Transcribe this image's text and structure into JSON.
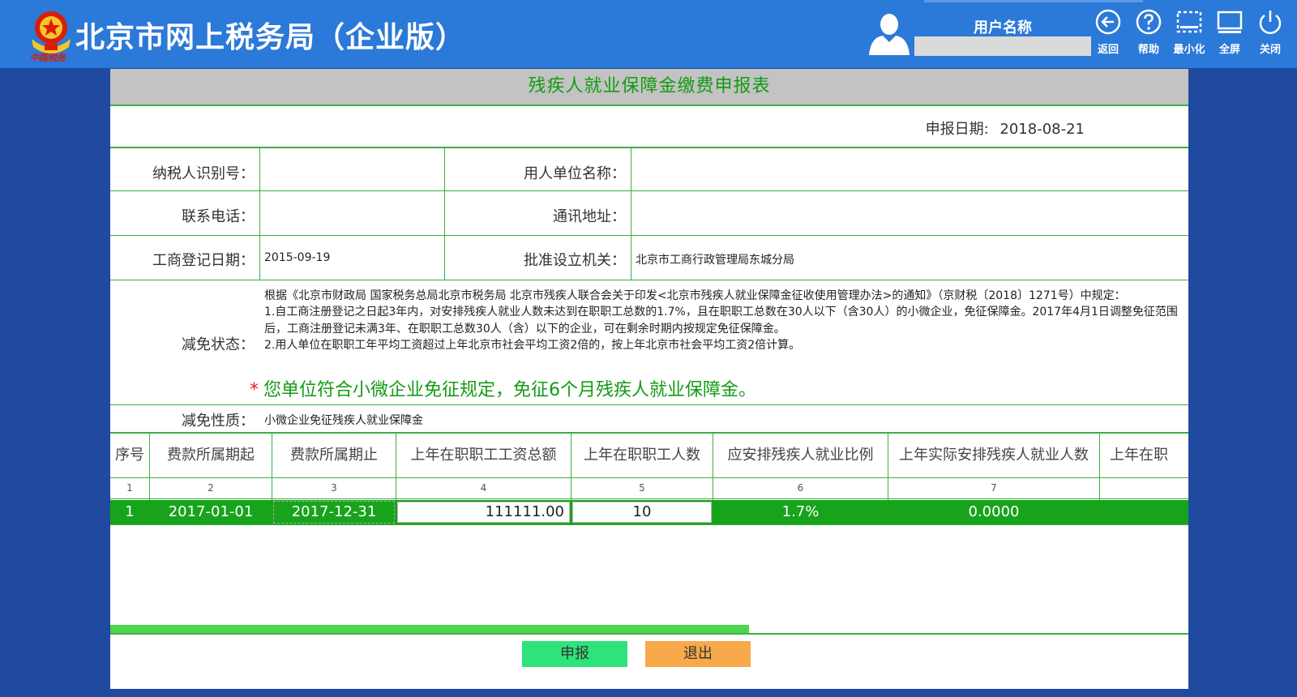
{
  "header": {
    "logo_caption": "中国税务",
    "title": "北京市网上税务局（企业版）",
    "user_label": "用户名称",
    "user_name": "",
    "buttons": [
      {
        "label": "返回",
        "icon": "back-arrow-icon"
      },
      {
        "label": "帮助",
        "icon": "help-icon"
      },
      {
        "label": "最小化",
        "icon": "minimize-icon"
      },
      {
        "label": "全屏",
        "icon": "fullscreen-icon"
      },
      {
        "label": "关闭",
        "icon": "power-icon"
      }
    ]
  },
  "form": {
    "title": "残疾人就业保障金缴费申报表",
    "date_label": "申报日期:",
    "date_value": "2018-08-21",
    "taxpayer_id_label": "纳税人识别号：",
    "taxpayer_id_value": "",
    "employer_name_label": "用人单位名称：",
    "employer_name_value": "",
    "phone_label": "联系电话：",
    "phone_value": "",
    "address_label": "通讯地址：",
    "address_value": "",
    "reg_date_label": "工商登记日期：",
    "reg_date_value": "2015-09-19",
    "approval_org_label": "批准设立机关：",
    "approval_org_value": "北京市工商行政管理局东城分局",
    "exemption_status_label": "减免状态：",
    "exemption_text": "根据《北京市财政局 国家税务总局北京市税务局 北京市残疾人联合会关于印发<北京市残疾人就业保障金征收使用管理办法>的通知》（京财税〔2018〕1271号）中规定：",
    "exemption_rule_1": "1.自工商注册登记之日起3年内，对安排残疾人就业人数未达到在职职工总数的1.7%，且在职职工总数在30人以下（含30人）的小微企业，免征保障金。2017年4月1日调整免征范围后，工商注册登记未满3年、在职职工总数30人（含）以下的企业，可在剩余时期内按规定免征保障金。",
    "exemption_rule_2": "2.用人单位在职职工年平均工资超过上年北京市社会平均工资2倍的，按上年北京市社会平均工资2倍计算。",
    "exemption_highlight_star": "*",
    "exemption_highlight": "您单位符合小微企业免征规定，免征6个月残疾人就业保障金。",
    "exemption_nature_label": "减免性质：",
    "exemption_nature_value": "小微企业免征残疾人就业保障金"
  },
  "grid": {
    "columns": [
      {
        "label": "序号",
        "num": "1"
      },
      {
        "label": "费款所属期起",
        "num": "2"
      },
      {
        "label": "费款所属期止",
        "num": "3"
      },
      {
        "label": "上年在职职工工资总额",
        "num": "4"
      },
      {
        "label": "上年在职职工人数",
        "num": "5"
      },
      {
        "label": "应安排残疾人就业比例",
        "num": "6"
      },
      {
        "label": "上年实际安排残疾人就业人数",
        "num": "7"
      },
      {
        "label": "上年在职",
        "num": ""
      }
    ],
    "row": {
      "seq": "1",
      "period_start": "2017-01-01",
      "period_end": "2017-12-31",
      "total_wages": "111111.00",
      "employee_count": "10",
      "ratio": "1.7%",
      "actual_disabled": "0.0000",
      "extra": ""
    }
  },
  "actions": {
    "submit_label": "申报",
    "exit_label": "退出"
  },
  "colors": {
    "header_bg": "#2b79d8",
    "page_bg": "#1f4aa0",
    "accent_green": "#18a31c",
    "title_green": "#139b13",
    "submit_bg": "#2ee37a",
    "exit_bg": "#f8a94a"
  }
}
